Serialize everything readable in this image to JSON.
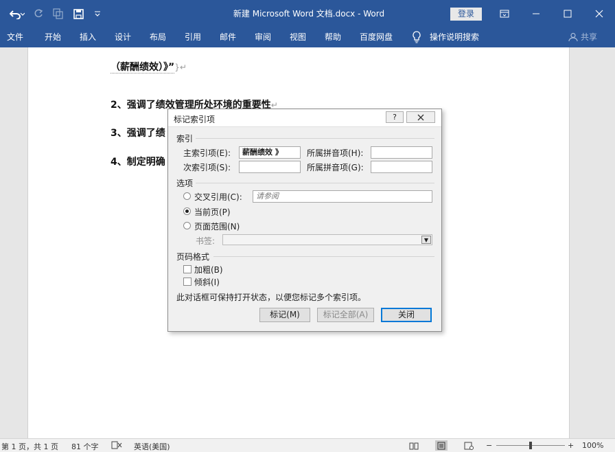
{
  "window": {
    "title": "新建 Microsoft Word 文档.docx  -  Word",
    "login_label": "登录"
  },
  "ribbon": {
    "tabs": [
      "文件",
      "开始",
      "插入",
      "设计",
      "布局",
      "引用",
      "邮件",
      "审阅",
      "视图",
      "帮助",
      "百度网盘"
    ],
    "tell_me": "操作说明搜索",
    "share": "共享"
  },
  "document": {
    "lines": [
      "（薪酬绩效）》”",
      "2、强调了绩效管理所处环境的重要性",
      "3、强调了绩",
      "4、制定明确"
    ]
  },
  "dialog": {
    "title": "标记索引项",
    "help_glyph": "?",
    "section_index": "索引",
    "main_entry_label": "主索引项(E):",
    "main_entry_value": "薪酬绩效 》",
    "main_pinyin_label": "所属拼音项(H):",
    "main_pinyin_value": "",
    "sub_entry_label": "次索引项(S):",
    "sub_entry_value": "",
    "sub_pinyin_label": "所属拼音项(G):",
    "sub_pinyin_value": "",
    "section_options": "选项",
    "cross_ref_label": "交叉引用(C):",
    "cross_ref_value": "请参阅",
    "current_page_label": "当前页(P)",
    "page_range_label": "页面范围(N)",
    "bookmark_label": "书签:",
    "selected_option": "current_page",
    "section_format": "页码格式",
    "bold_label": "加粗(B)",
    "bold_checked": false,
    "italic_label": "倾斜(I)",
    "italic_checked": false,
    "info_text": "此对话框可保持打开状态，以便您标记多个索引项。",
    "mark_button": "标记(M)",
    "mark_all_button": "标记全部(A)",
    "close_button": "关闭"
  },
  "status": {
    "page": "第 1 页，共 1 页",
    "words": "81 个字",
    "language": "英语(美国)",
    "zoom": "100%",
    "zoom_out": "−",
    "zoom_in": "+"
  },
  "colors": {
    "ribbon": "#2b579a",
    "accent": "#0078d7"
  }
}
